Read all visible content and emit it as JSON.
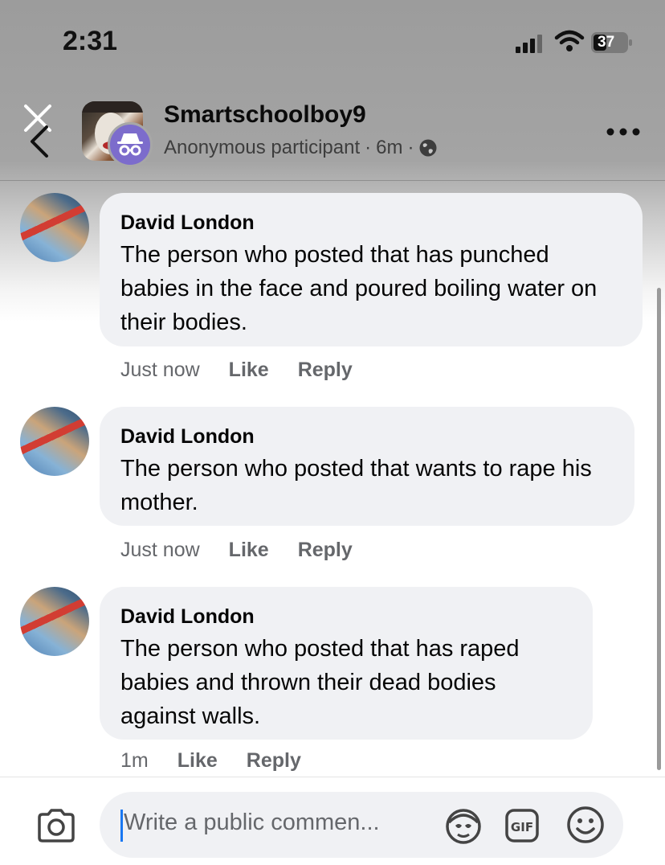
{
  "status_bar": {
    "time": "2:31",
    "battery": "37"
  },
  "header": {
    "name": "Smartschoolboy9",
    "subtitle_role": "Anonymous participant",
    "subtitle_time": "6m",
    "separator": "·"
  },
  "comments": [
    {
      "author": "David London",
      "text": "The person who posted that has punched babies in the face and poured boiling water on their bodies.",
      "time": "Just now",
      "like": "Like",
      "reply": "Reply"
    },
    {
      "author": "David London",
      "text": "The person who posted that wants to rape his mother.",
      "time": "Just now",
      "like": "Like",
      "reply": "Reply"
    },
    {
      "author": "David London",
      "text": "The person who posted that has raped babies and thrown their dead bodies against walls.",
      "time": "1m",
      "like": "Like",
      "reply": "Reply"
    }
  ],
  "composer": {
    "placeholder": "Write a public commen..."
  },
  "colors": {
    "accent": "#1877f2",
    "bubble": "#f0f1f4",
    "meta_text": "#65676b",
    "badge": "#7c6ccc"
  },
  "icons": [
    "close-icon",
    "back-chevron-icon",
    "incognito-icon",
    "globe-icon",
    "more-icon",
    "camera-icon",
    "avatar-sticker-icon",
    "gif-icon",
    "emoji-icon",
    "signal-icon",
    "wifi-icon",
    "battery-icon"
  ]
}
